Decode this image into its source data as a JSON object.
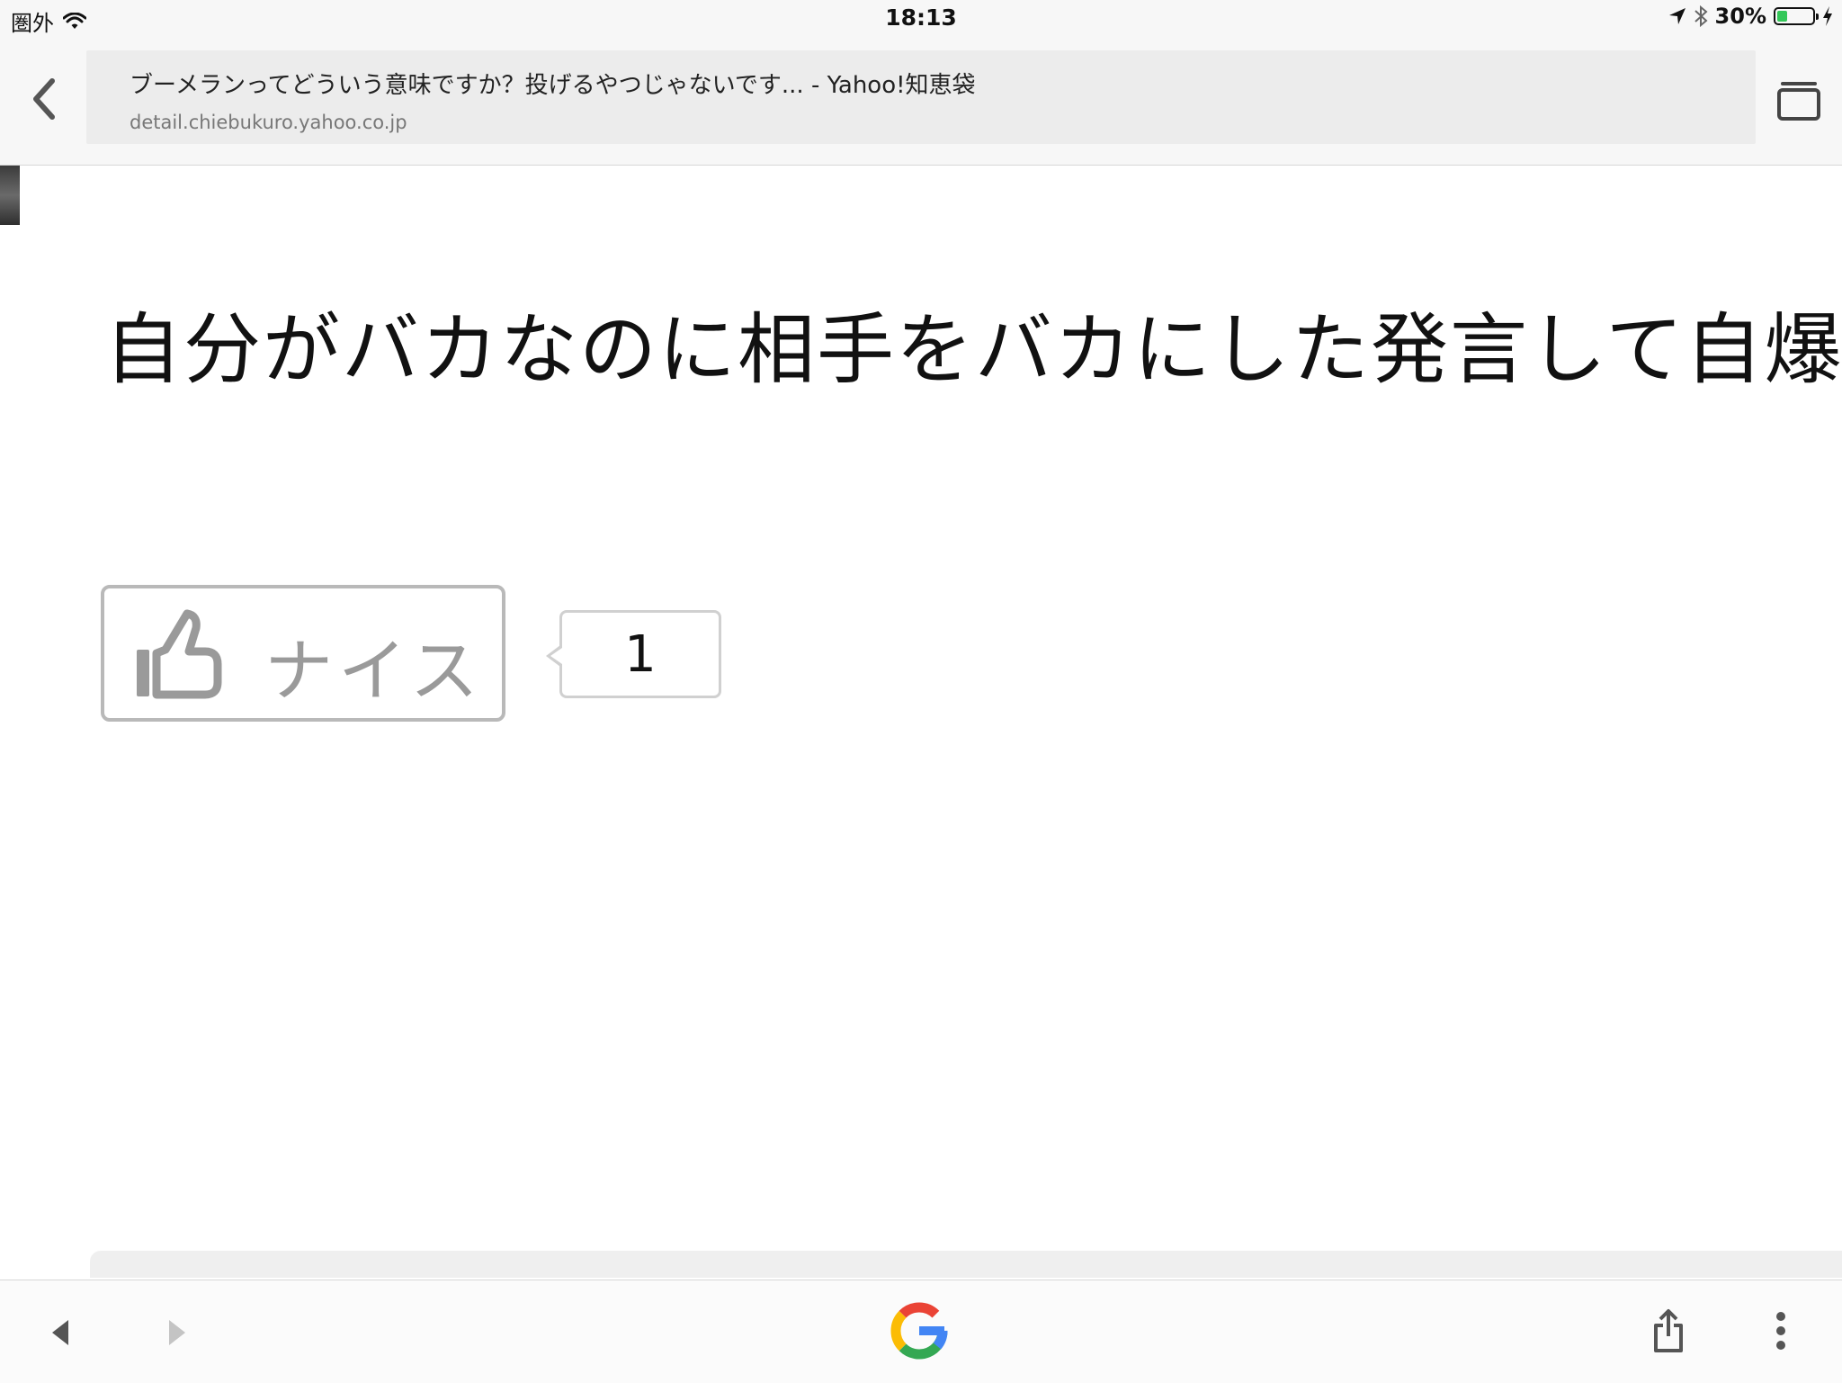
{
  "status_bar": {
    "carrier": "圏外",
    "time": "18:13",
    "battery_percent": "30%",
    "battery_level": 0.3,
    "battery_color": "#34c759"
  },
  "toolbar": {
    "back_icon": "chevron-left-icon",
    "page_title": "ブーメランってどういう意味ですか？投げるやつじゃないです... - Yahoo!知恵袋",
    "page_url": "detail.chiebukuro.yahoo.co.jp",
    "tabs_icon": "tabs-icon"
  },
  "content": {
    "answer_text": "自分がバカなのに相手をバカにした発言して自爆",
    "nice_button_label": "ナイス",
    "nice_count": "1"
  },
  "bottom_bar": {
    "icons": [
      "back-arrow-icon",
      "forward-arrow-icon",
      "google-logo",
      "share-icon",
      "more-vert-icon"
    ],
    "google_colors": [
      "#4285f4",
      "#ea4335",
      "#fbbc05",
      "#34a853"
    ]
  }
}
